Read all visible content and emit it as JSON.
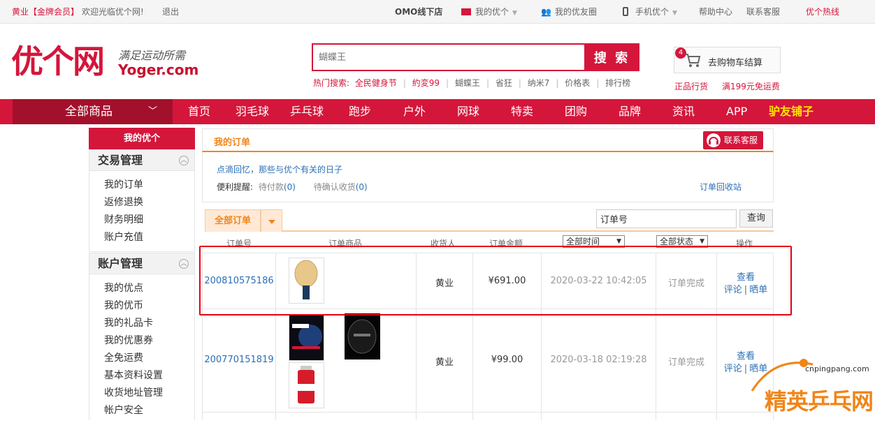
{
  "topbar": {
    "username": "黄业",
    "member": "【金牌会员】",
    "welcome": "欢迎光临优个网!",
    "logout": "退出",
    "omo": "OMO线下店",
    "my_yoger": "我的优个",
    "friends": "我的优友圈",
    "mobile": "手机优个",
    "help": "帮助中心",
    "service": "联系客服",
    "hotline": "优个热线"
  },
  "header": {
    "logo_cn": "优个网",
    "logo_slogan": "满足运动所需",
    "logo_en": "Yoger.com",
    "search_placeholder": "蝴蝶王",
    "search_button": "搜 索",
    "hot_label": "热门搜索:",
    "hot_terms": [
      "全民健身节",
      "約変99",
      "蝴蝶王",
      "省狂",
      "纳米7",
      "价格表",
      "排行榜"
    ],
    "cart_count": "4",
    "cart_label": "去购物车结算",
    "promo_1": "正品行货",
    "promo_2": "满199元免运费"
  },
  "nav": {
    "all": "全部商品",
    "items": [
      "首页",
      "羽毛球",
      "乒乓球",
      "跑步",
      "户外",
      "网球",
      "特卖",
      "团购",
      "品牌",
      "资讯",
      "APP"
    ],
    "special": "驴友铺子"
  },
  "sidebar": {
    "head": "我的优个",
    "sections": [
      {
        "title": "交易管理",
        "items": [
          "我的订单",
          "返修退换",
          "财务明细",
          "账户充值"
        ]
      },
      {
        "title": "账户管理",
        "items": [
          "我的优点",
          "我的优币",
          "我的礼品卡",
          "我的优惠券",
          "全免运费",
          "基本资料设置",
          "收货地址管理",
          "帐户安全"
        ]
      }
    ]
  },
  "main": {
    "title": "我的订单",
    "cs_button": "联系客服",
    "memory": "点滴回忆，那些与优个有关的日子",
    "reminder_label": "便利提醒:",
    "pending_pay": "待付款",
    "pending_pay_count": "(0)",
    "pending_receive": "待确认收货",
    "pending_receive_count": "(0)",
    "recycle": "订单回收站",
    "tab_all": "全部订单",
    "order_search": "订单号",
    "query": "查询",
    "columns": {
      "order_no": "订单号",
      "goods": "订单商品",
      "receiver": "收货人",
      "amount": "订单金额",
      "time_filter": "全部时间",
      "status_filter": "全部状态",
      "ops": "操作"
    },
    "orders": [
      {
        "no": "200810575186",
        "receiver": "黄业",
        "amount": "¥691.00",
        "time": "2020-03-22 10:42:05",
        "status": "订单完成",
        "view": "查看",
        "comment": "评论",
        "share": "晒单"
      },
      {
        "no": "200770151819",
        "receiver": "黄业",
        "amount": "¥99.00",
        "time": "2020-03-18 02:19:28",
        "status": "订单完成",
        "view": "查看",
        "comment": "评论",
        "share": "晒单"
      }
    ]
  },
  "watermark": {
    "site": "cnpingpang.com",
    "name": "精英乒乓网"
  },
  "colors": {
    "brand": "#d4163b",
    "accent": "#f08519",
    "link": "#2b6fb6"
  }
}
